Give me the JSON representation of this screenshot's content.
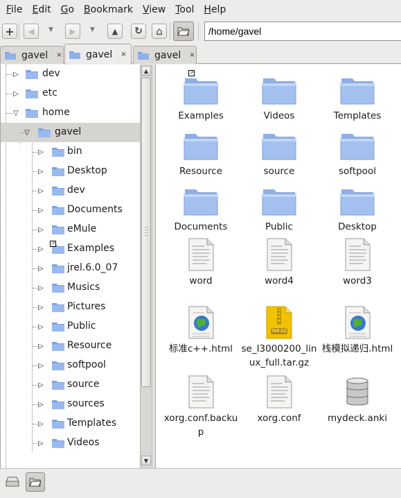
{
  "menubar": {
    "items": [
      {
        "underline": "F",
        "rest": "ile"
      },
      {
        "underline": "E",
        "rest": "dit"
      },
      {
        "underline": "G",
        "rest": "o"
      },
      {
        "underline": "B",
        "rest": "ookmark"
      },
      {
        "underline": "V",
        "rest": "iew"
      },
      {
        "underline": "T",
        "rest": "ool"
      },
      {
        "underline": "H",
        "rest": "elp"
      }
    ]
  },
  "toolbar": {
    "new_tab_glyph": "+",
    "back_glyph": "◀",
    "back_menu_glyph": "▼",
    "forward_glyph": "▶",
    "forward_menu_glyph": "▼",
    "up_glyph": "▲",
    "reload_glyph": "↻",
    "home_glyph": "⌂",
    "location_value": "/home/gavel"
  },
  "tabs": [
    {
      "label": "gavel",
      "close": "×"
    },
    {
      "label": "gavel",
      "close": "×"
    },
    {
      "label": "gavel",
      "close": "×"
    }
  ],
  "tree": {
    "rows": [
      {
        "label": "dev",
        "expander": "▷"
      },
      {
        "label": "etc",
        "expander": "▷"
      },
      {
        "label": "home",
        "expander": "▽"
      },
      {
        "label": "gavel",
        "expander": "▽"
      },
      {
        "label": "bin",
        "expander": "▷"
      },
      {
        "label": "Desktop",
        "expander": "▷"
      },
      {
        "label": "dev",
        "expander": "▷"
      },
      {
        "label": "Documents",
        "expander": "▷"
      },
      {
        "label": "eMule",
        "expander": "▷"
      },
      {
        "label": "Examples",
        "expander": "▷"
      },
      {
        "label": "jrel.6.0_07",
        "expander": "▷"
      },
      {
        "label": "Musics",
        "expander": "▷"
      },
      {
        "label": "Pictures",
        "expander": "▷"
      },
      {
        "label": "Public",
        "expander": "▷"
      },
      {
        "label": "Resource",
        "expander": "▷"
      },
      {
        "label": "softpool",
        "expander": "▷"
      },
      {
        "label": "source",
        "expander": "▷"
      },
      {
        "label": "sources",
        "expander": "▷"
      },
      {
        "label": "Templates",
        "expander": "▷"
      },
      {
        "label": "Videos",
        "expander": "▷"
      }
    ],
    "scroll_up_glyph": "▲",
    "scroll_down_glyph": "▼"
  },
  "files": [
    {
      "name": "Examples",
      "type": "folder-icon"
    },
    {
      "name": "Videos",
      "type": "folder-icon"
    },
    {
      "name": "Templates",
      "type": "folder-icon"
    },
    {
      "name": "Resource",
      "type": "folder-icon"
    },
    {
      "name": "source",
      "type": "folder-icon"
    },
    {
      "name": "softpool",
      "type": "folder-icon"
    },
    {
      "name": "Documents",
      "type": "folder-icon"
    },
    {
      "name": "Public",
      "type": "folder-icon"
    },
    {
      "name": "Desktop",
      "type": "folder-icon"
    },
    {
      "name": "word",
      "type": "text-file-icon"
    },
    {
      "name": "word4",
      "type": "text-file-icon"
    },
    {
      "name": "word3",
      "type": "text-file-icon"
    },
    {
      "name": "标准c++.html",
      "type": "html-file-icon"
    },
    {
      "name": "se_I3000200_linux_full.tar.gz",
      "type": "archive-icon",
      "badge": "TAR.GZ"
    },
    {
      "name": "栈模拟递归.html",
      "type": "html-file-icon"
    },
    {
      "name": "xorg.conf.backup",
      "type": "text-file-icon"
    },
    {
      "name": "xorg.conf",
      "type": "text-file-icon"
    },
    {
      "name": "mydeck.anki",
      "type": "database-icon"
    }
  ],
  "colors": {
    "folder_top": "#a9c3ec",
    "folder_body": "#7aa3e6",
    "selection": "#d6d4d0",
    "archive": "#f5c400"
  }
}
